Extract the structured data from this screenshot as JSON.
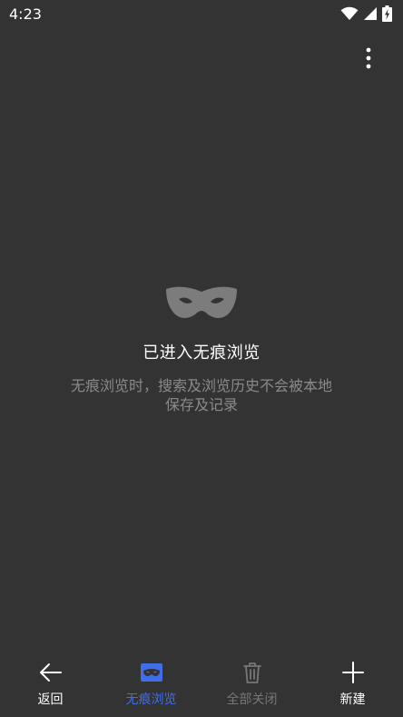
{
  "status_bar": {
    "time": "4:23",
    "icons": [
      "wifi-icon",
      "signal-icon",
      "battery-charging-icon"
    ]
  },
  "menu": {
    "icon": "more-vertical-icon"
  },
  "incognito": {
    "icon": "mask-icon",
    "title": "已进入无痕浏览",
    "description": "无痕浏览时，搜索及浏览历史不会被本地保存及记录"
  },
  "bottom_nav": {
    "back": {
      "label": "返回",
      "icon": "arrow-left-icon"
    },
    "incognito": {
      "label": "无痕浏览",
      "icon": "incognito-mask-icon"
    },
    "close_all": {
      "label": "全部关闭",
      "icon": "trash-icon"
    },
    "new_tab": {
      "label": "新建",
      "icon": "plus-icon"
    }
  },
  "colors": {
    "background": "#333333",
    "text_primary": "#ffffff",
    "text_secondary": "#8a8a8a",
    "accent": "#3f6ee8",
    "disabled": "#777777"
  }
}
